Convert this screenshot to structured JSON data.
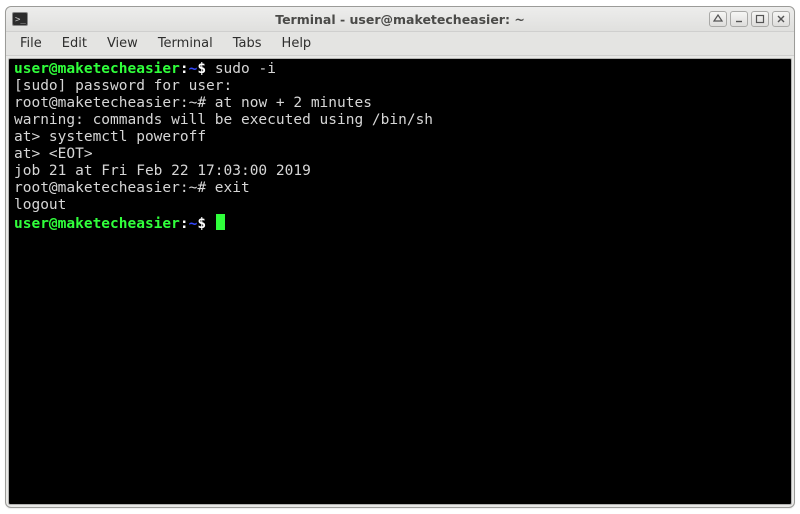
{
  "window": {
    "title": "Terminal - user@maketecheasier: ~"
  },
  "menu": {
    "file": "File",
    "edit": "Edit",
    "view": "View",
    "terminal": "Terminal",
    "tabs": "Tabs",
    "help": "Help"
  },
  "term": {
    "line1_user": "user@maketecheasier",
    "line1_colon": ":",
    "line1_path": "~",
    "line1_suffix": "$ ",
    "line1_cmd": "sudo -i",
    "line2": "[sudo] password for user: ",
    "line3_prompt": "root@maketecheasier:~# ",
    "line3_cmd": "at now + 2 minutes",
    "line4": "warning: commands will be executed using /bin/sh",
    "line5_prompt": "at> ",
    "line5_cmd": "systemctl poweroff",
    "line6_prompt": "at> ",
    "line6_cmd": "<EOT>",
    "line7": "job 21 at Fri Feb 22 17:03:00 2019",
    "line8_prompt": "root@maketecheasier:~# ",
    "line8_cmd": "exit",
    "line9": "logout",
    "line10_user": "user@maketecheasier",
    "line10_colon": ":",
    "line10_path": "~",
    "line10_suffix": "$ "
  }
}
